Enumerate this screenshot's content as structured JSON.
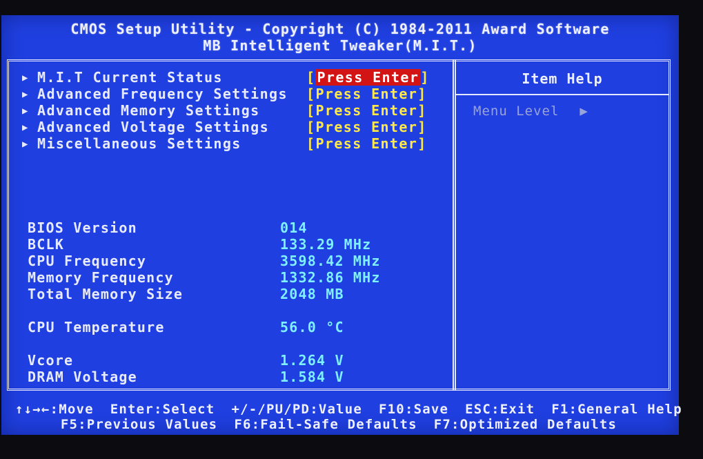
{
  "header": {
    "line1": "CMOS Setup Utility - Copyright (C) 1984-2011 Award Software",
    "line2": "MB Intelligent Tweaker(M.I.T.)"
  },
  "menu": {
    "items": [
      {
        "label": "M.I.T Current Status",
        "value": "[Press Enter]",
        "selected": true
      },
      {
        "label": "Advanced Frequency Settings",
        "value": "[Press Enter]"
      },
      {
        "label": "Advanced Memory Settings",
        "value": "[Press Enter]"
      },
      {
        "label": "Advanced Voltage Settings",
        "value": "[Press Enter]"
      },
      {
        "label": "Miscellaneous Settings",
        "value": "[Press Enter]"
      }
    ],
    "selected_press_left": "[",
    "selected_press_inner": "Press Enter",
    "selected_press_right": "]"
  },
  "info": {
    "bios_version": {
      "label": "BIOS Version",
      "value": "014"
    },
    "bclk": {
      "label": "BCLK",
      "value": "133.29 MHz"
    },
    "cpu_frequency": {
      "label": "CPU Frequency",
      "value": "3598.42 MHz"
    },
    "memory_frequency": {
      "label": "Memory Frequency",
      "value": "1332.86 MHz"
    },
    "total_memory": {
      "label": "Total Memory Size",
      "value": "2048 MB"
    },
    "cpu_temperature": {
      "label": "CPU Temperature",
      "value": "56.0 °C"
    },
    "vcore": {
      "label": "Vcore",
      "value": "1.264 V"
    },
    "dram_voltage": {
      "label": "DRAM Voltage",
      "value": "1.584 V"
    }
  },
  "help": {
    "title": "Item Help",
    "menu_level": "Menu Level",
    "menu_level_arrow": "▶"
  },
  "footer": {
    "move": "↑↓→←:Move",
    "select": "Enter:Select",
    "value": "+/-/PU/PD:Value",
    "save": "F10:Save",
    "exit": "ESC:Exit",
    "help": "F1:General Help",
    "previous": "F5:Previous Values",
    "failsafe": "F6:Fail-Safe Defaults",
    "optimized": "F7:Optimized Defaults"
  },
  "colors": {
    "background": "#1f3fe0",
    "text": "#e8ebff",
    "value": "#7ff0ff",
    "press_enter": "#ffe94a",
    "highlight": "#d21414"
  }
}
